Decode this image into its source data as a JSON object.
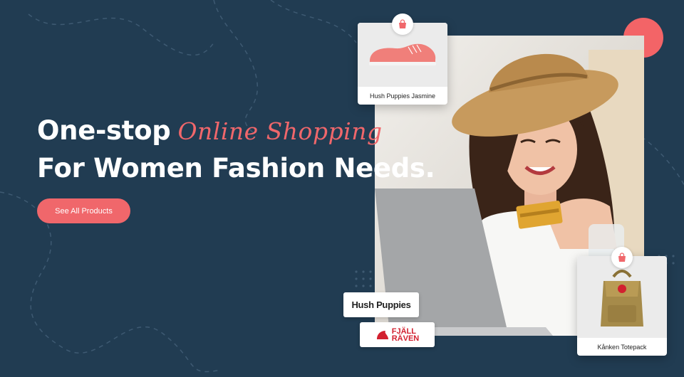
{
  "hero": {
    "headline_part1": "One-stop",
    "headline_script": "Online Shopping",
    "headline_line2": "For Women Fashion Needs.",
    "cta_label": "See All Products"
  },
  "products": [
    {
      "name": "Hush Puppies Jasmine",
      "icon": "bag-icon"
    },
    {
      "name": "Kånken Totepack",
      "icon": "bag-icon"
    }
  ],
  "brands": {
    "hush_puppies": "Hush Puppies",
    "fjallraven_line1": "FJÄLL",
    "fjallraven_line2": "RÄVEN"
  },
  "colors": {
    "background": "#213c52",
    "accent": "#f0676b",
    "text": "#ffffff"
  }
}
